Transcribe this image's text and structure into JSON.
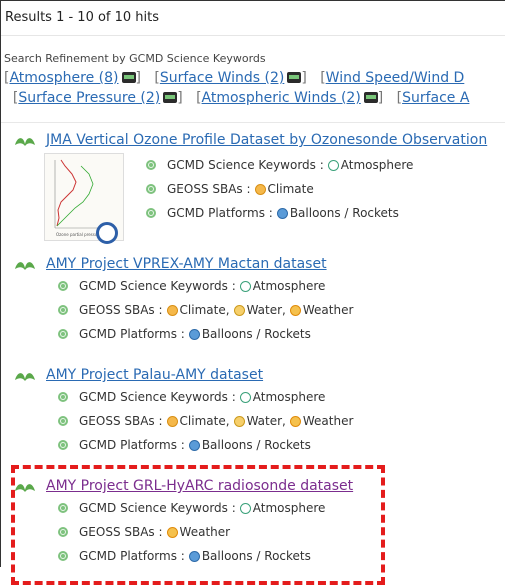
{
  "results_header": "Results 1 - 10 of 10 hits",
  "refinement": {
    "title": "Search Refinement by GCMD Science Keywords",
    "row1": [
      {
        "label": "Atmosphere (8)"
      },
      {
        "label": "Surface Winds (2)"
      },
      {
        "label": "Wind Speed/Wind D"
      }
    ],
    "row2": [
      {
        "label": "Surface Pressure (2)"
      },
      {
        "label": "Atmospheric Winds (2)"
      },
      {
        "label": "Surface A"
      }
    ]
  },
  "labels": {
    "science": "GCMD Science Keywords : ",
    "sbas": "GEOSS SBAs : ",
    "platforms": "GCMD Platforms : ",
    "comma": ",",
    "pipe": "|"
  },
  "results": [
    {
      "title": "JMA  Vertical Ozone Profile Dataset by Ozonesonde Observation",
      "science": "Atmosphere",
      "sbas": [
        "Climate"
      ],
      "platforms": "Balloons / Rockets",
      "thumbnail_caption": "Ozone partial pressure (mPa)"
    },
    {
      "title": "AMY Project VPREX-AMY  Mactan dataset",
      "science": "Atmosphere",
      "sbas": [
        "Climate",
        "Water",
        "Weather"
      ],
      "platforms": "Balloons / Rockets"
    },
    {
      "title": "AMY Project Palau-AMY dataset",
      "science": "Atmosphere",
      "sbas": [
        "Climate",
        "Water",
        "Weather"
      ],
      "platforms": "Balloons / Rockets"
    },
    {
      "title": "AMY Project GRL-HyARC radiosonde dataset",
      "science": "Atmosphere",
      "sbas": [
        "Weather"
      ],
      "platforms": "Balloons / Rockets"
    }
  ],
  "colors": {
    "link": "#2a6ab3",
    "visited_link": "#7b2d8e",
    "highlight_box": "#e41c1c",
    "leaf_icon": "#5aa84a"
  },
  "icons": [
    "leaf-icon",
    "globe-icon",
    "atmosphere-icon",
    "climate-icon",
    "water-icon",
    "weather-icon",
    "balloon-icon",
    "keyword-badge-icon"
  ]
}
